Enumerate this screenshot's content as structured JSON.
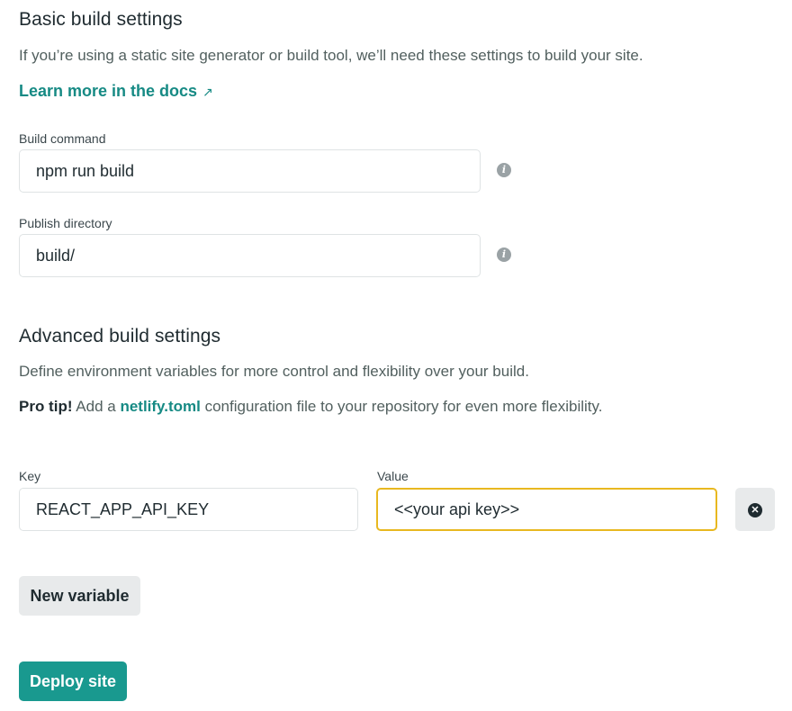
{
  "basic": {
    "title": "Basic build settings",
    "description": "If you’re using a static site generator or build tool, we’ll need these settings to build your site.",
    "learn_more": "Learn more in the docs",
    "learn_more_arrow": "↗",
    "build_command": {
      "label": "Build command",
      "value": "npm run build",
      "info_icon": "info-icon"
    },
    "publish_directory": {
      "label": "Publish directory",
      "value": "build/",
      "info_icon": "info-icon"
    }
  },
  "advanced": {
    "title": "Advanced build settings",
    "description": "Define environment variables for more control and flexibility over your build.",
    "pro_tip_bold": "Pro tip!",
    "pro_tip_pre": " Add a ",
    "pro_tip_link": "netlify.toml",
    "pro_tip_post": " configuration file to your repository for even more flexibility.",
    "key_label": "Key",
    "value_label": "Value",
    "variable": {
      "key": "REACT_APP_API_KEY",
      "value": "<<your api key>>"
    },
    "remove_icon": "close-circle-icon",
    "new_variable_label": "New variable"
  },
  "deploy_label": "Deploy site",
  "colors": {
    "accent": "#19998f",
    "link": "#168a84",
    "focus": "#e8b820"
  }
}
